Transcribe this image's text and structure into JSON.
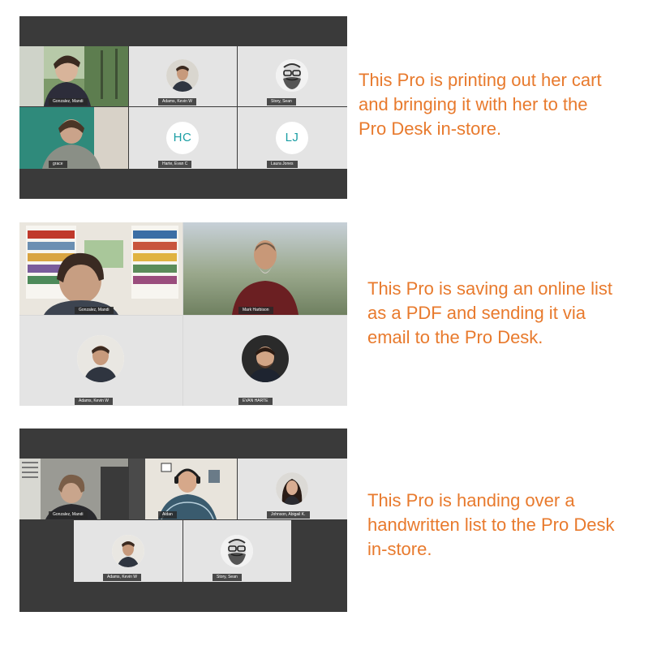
{
  "meetings": [
    {
      "participants": [
        {
          "name": "Gonzalez, Mandi",
          "view": "video"
        },
        {
          "name": "Adams, Kevin W",
          "view": "photo",
          "icon": "person-photo-icon"
        },
        {
          "name": "Story, Sean",
          "view": "photo",
          "icon": "bearded-man-illustration-icon"
        },
        {
          "name": "grace",
          "view": "video"
        },
        {
          "name": "Harte, Evan C",
          "view": "initials",
          "initials": "HC"
        },
        {
          "name": "Laura Jones",
          "view": "initials",
          "initials": "LJ"
        }
      ],
      "caption": [
        "This Pro is printing out her cart",
        "and bringing it with her to the",
        "Pro Desk in-store."
      ]
    },
    {
      "participants": [
        {
          "name": "Gonzalez, Mandi",
          "view": "video"
        },
        {
          "name": "Mark Harbison",
          "view": "video"
        },
        {
          "name": "Adams, Kevin W",
          "view": "photo",
          "icon": "person-photo-icon"
        },
        {
          "name": "EVAN HARTE",
          "view": "photo",
          "icon": "person-photo-icon"
        }
      ],
      "caption": [
        "This Pro is saving an online list",
        "as a PDF and sending it via",
        "email to the Pro Desk."
      ]
    },
    {
      "participants": [
        {
          "name": "Gonzalez, Mandi",
          "view": "video"
        },
        {
          "name": "Aidan",
          "view": "video"
        },
        {
          "name": "Johnson, Abigail K.",
          "view": "photo",
          "icon": "person-photo-icon"
        },
        {
          "name": "Adams, Kevin W",
          "view": "photo",
          "icon": "person-photo-icon"
        },
        {
          "name": "Story, Sean",
          "view": "photo",
          "icon": "bearded-man-illustration-icon"
        }
      ],
      "caption": [
        "This Pro is handing over a",
        "handwritten list to the Pro Desk",
        "in-store."
      ]
    }
  ],
  "colors": {
    "caption": "#e87a2d",
    "frame": "#3a3a3a",
    "tile": "#e4e4e4",
    "initials": "#1a9ea4"
  }
}
